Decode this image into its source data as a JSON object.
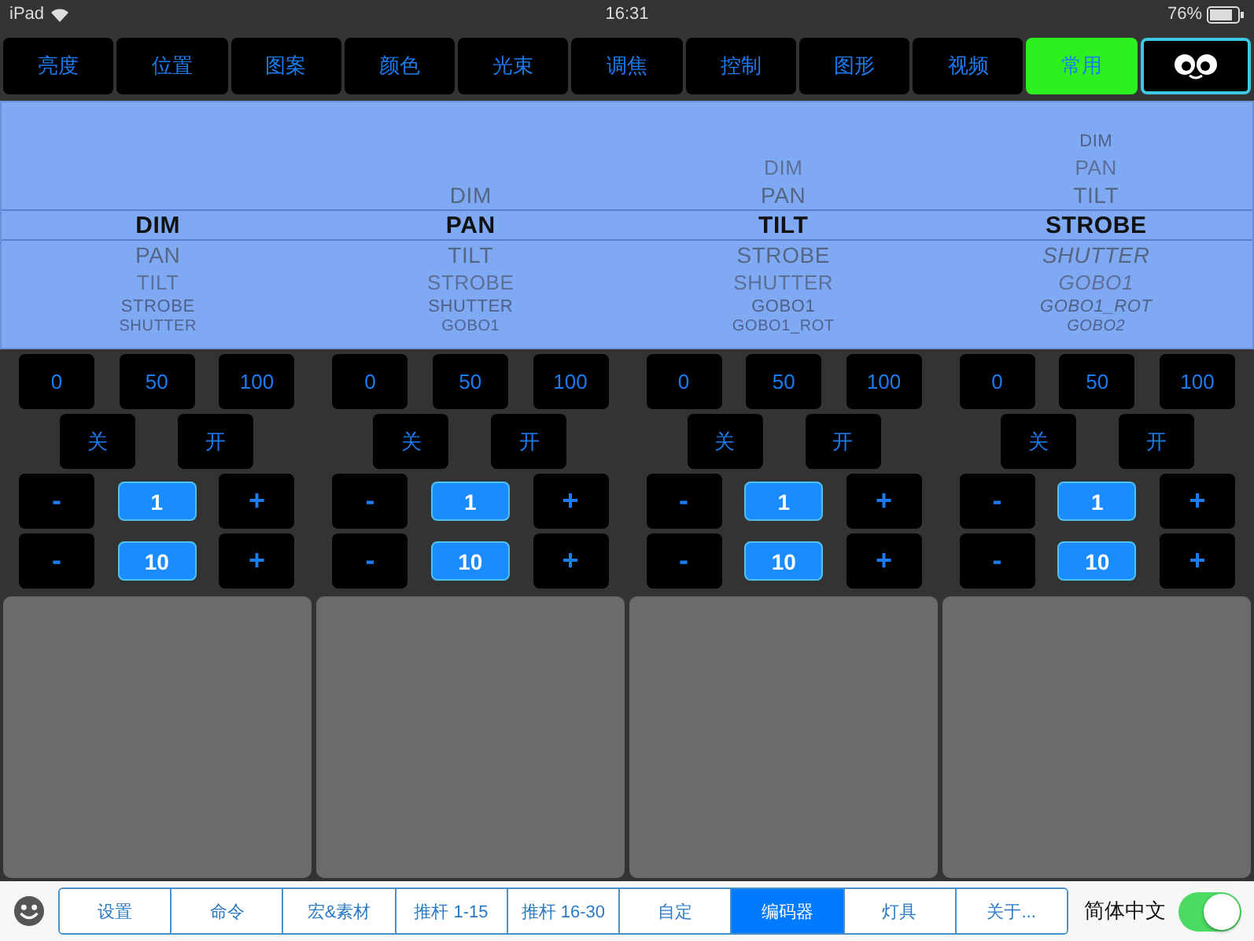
{
  "status_bar": {
    "device": "iPad",
    "time": "16:31",
    "battery": "76%"
  },
  "tabs": [
    {
      "label": "亮度",
      "selected": false
    },
    {
      "label": "位置",
      "selected": false
    },
    {
      "label": "图案",
      "selected": false
    },
    {
      "label": "颜色",
      "selected": false
    },
    {
      "label": "光束",
      "selected": false
    },
    {
      "label": "调焦",
      "selected": false
    },
    {
      "label": "控制",
      "selected": false
    },
    {
      "label": "图形",
      "selected": false
    },
    {
      "label": "视频",
      "selected": false
    },
    {
      "label": "常用",
      "selected": true
    }
  ],
  "encoders": [
    {
      "attributes": [
        {
          "label": "DIM",
          "selected": true
        },
        {
          "label": "PAN",
          "selected": false
        },
        {
          "label": "TILT",
          "selected": false
        },
        {
          "label": "STROBE",
          "selected": false
        },
        {
          "label": "SHUTTER",
          "selected": false
        }
      ],
      "presets": [
        "0",
        "50",
        "100"
      ],
      "switches": [
        "关",
        "开"
      ],
      "steps": [
        {
          "minus": "-",
          "value": "1",
          "plus": "+"
        },
        {
          "minus": "-",
          "value": "10",
          "plus": "+"
        }
      ]
    },
    {
      "attributes": [
        {
          "label": "DIM",
          "selected": false
        },
        {
          "label": "PAN",
          "selected": true
        },
        {
          "label": "TILT",
          "selected": false
        },
        {
          "label": "STROBE",
          "selected": false
        },
        {
          "label": "SHUTTER",
          "selected": false
        },
        {
          "label": "GOBO1",
          "selected": false
        }
      ],
      "presets": [
        "0",
        "50",
        "100"
      ],
      "switches": [
        "关",
        "开"
      ],
      "steps": [
        {
          "minus": "-",
          "value": "1",
          "plus": "+"
        },
        {
          "minus": "-",
          "value": "10",
          "plus": "+"
        }
      ]
    },
    {
      "attributes": [
        {
          "label": "DIM",
          "selected": false
        },
        {
          "label": "PAN",
          "selected": false
        },
        {
          "label": "TILT",
          "selected": true
        },
        {
          "label": "STROBE",
          "selected": false
        },
        {
          "label": "SHUTTER",
          "selected": false
        },
        {
          "label": "GOBO1",
          "selected": false
        },
        {
          "label": "GOBO1_ROT",
          "selected": false
        }
      ],
      "presets": [
        "0",
        "50",
        "100"
      ],
      "switches": [
        "关",
        "开"
      ],
      "steps": [
        {
          "minus": "-",
          "value": "1",
          "plus": "+"
        },
        {
          "minus": "-",
          "value": "10",
          "plus": "+"
        }
      ]
    },
    {
      "attributes": [
        {
          "label": "DIM",
          "selected": false
        },
        {
          "label": "PAN",
          "selected": false
        },
        {
          "label": "TILT",
          "selected": false
        },
        {
          "label": "STROBE",
          "selected": true
        },
        {
          "label": "SHUTTER",
          "selected": false
        },
        {
          "label": "GOBO1",
          "selected": false
        },
        {
          "label": "GOBO1_ROT",
          "selected": false
        },
        {
          "label": "GOBO2",
          "selected": false
        }
      ],
      "presets": [
        "0",
        "50",
        "100"
      ],
      "switches": [
        "关",
        "开"
      ],
      "steps": [
        {
          "minus": "-",
          "value": "1",
          "plus": "+"
        },
        {
          "minus": "-",
          "value": "10",
          "plus": "+"
        }
      ]
    }
  ],
  "bottom_tabs": [
    {
      "label": "设置",
      "selected": false
    },
    {
      "label": "命令",
      "selected": false
    },
    {
      "label": "宏&素材",
      "selected": false
    },
    {
      "label": "推杆 1-15",
      "selected": false
    },
    {
      "label": "推杆 16-30",
      "selected": false
    },
    {
      "label": "自定",
      "selected": false
    },
    {
      "label": "编码器",
      "selected": true
    },
    {
      "label": "灯具",
      "selected": false
    },
    {
      "label": "关于...",
      "selected": false
    }
  ],
  "language": {
    "label": "简体中文",
    "on": true
  }
}
